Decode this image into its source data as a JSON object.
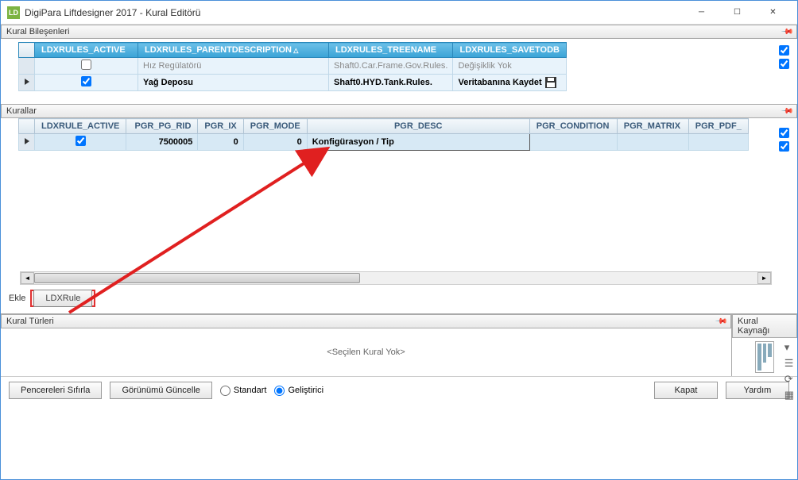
{
  "window": {
    "title": "DigiPara Liftdesigner 2017 - Kural Editörü",
    "icon_label": "LD"
  },
  "panel_components": {
    "title": "Kural Bileşenleri",
    "headers": {
      "active": "LDXRULES_ACTIVE",
      "parent_desc": "LDXRULES_PARENTDESCRIPTION",
      "treename": "LDXRULES_TREENAME",
      "savetodb": "LDXRULES_SAVETODB"
    },
    "rows": [
      {
        "active": false,
        "parent_desc": "Hız Regülatörü",
        "treename": "Shaft0.Car.Frame.Gov.Rules.",
        "savetodb": "Değişiklik Yok",
        "selected": false,
        "bold": false
      },
      {
        "active": true,
        "parent_desc": "Yağ Deposu",
        "treename": "Shaft0.HYD.Tank.Rules.",
        "savetodb": "Veritabanına Kaydet",
        "selected": true,
        "bold": true
      }
    ]
  },
  "panel_rules": {
    "title": "Kurallar",
    "headers": {
      "active": "LDXRULE_ACTIVE",
      "pg_rid": "PGR_PG_RID",
      "pgr_ix": "PGR_IX",
      "pgr_mode": "PGR_MODE",
      "pgr_desc": "PGR_DESC",
      "pgr_condition": "PGR_CONDITION",
      "pgr_matrix": "PGR_MATRIX",
      "pgr_pdf": "PGR_PDF_"
    },
    "rows": [
      {
        "active": true,
        "pg_rid": "7500005",
        "ix": "0",
        "mode": "0",
        "desc": "Konfigürasyon / Tip",
        "condition": "",
        "matrix": "",
        "pdf": ""
      }
    ],
    "add_label": "Ekle",
    "add_button": "LDXRule"
  },
  "panel_types": {
    "title": "Kural Türleri",
    "empty_text": "<Seçilen Kural Yok>"
  },
  "panel_source": {
    "title": "Kural Kaynağı"
  },
  "footer": {
    "reset_windows": "Pencereleri Sıfırla",
    "refresh_view": "Görünümü Güncelle",
    "standard": "Standart",
    "developer": "Geliştirici",
    "close": "Kapat",
    "help": "Yardım",
    "mode_selected": "developer"
  }
}
